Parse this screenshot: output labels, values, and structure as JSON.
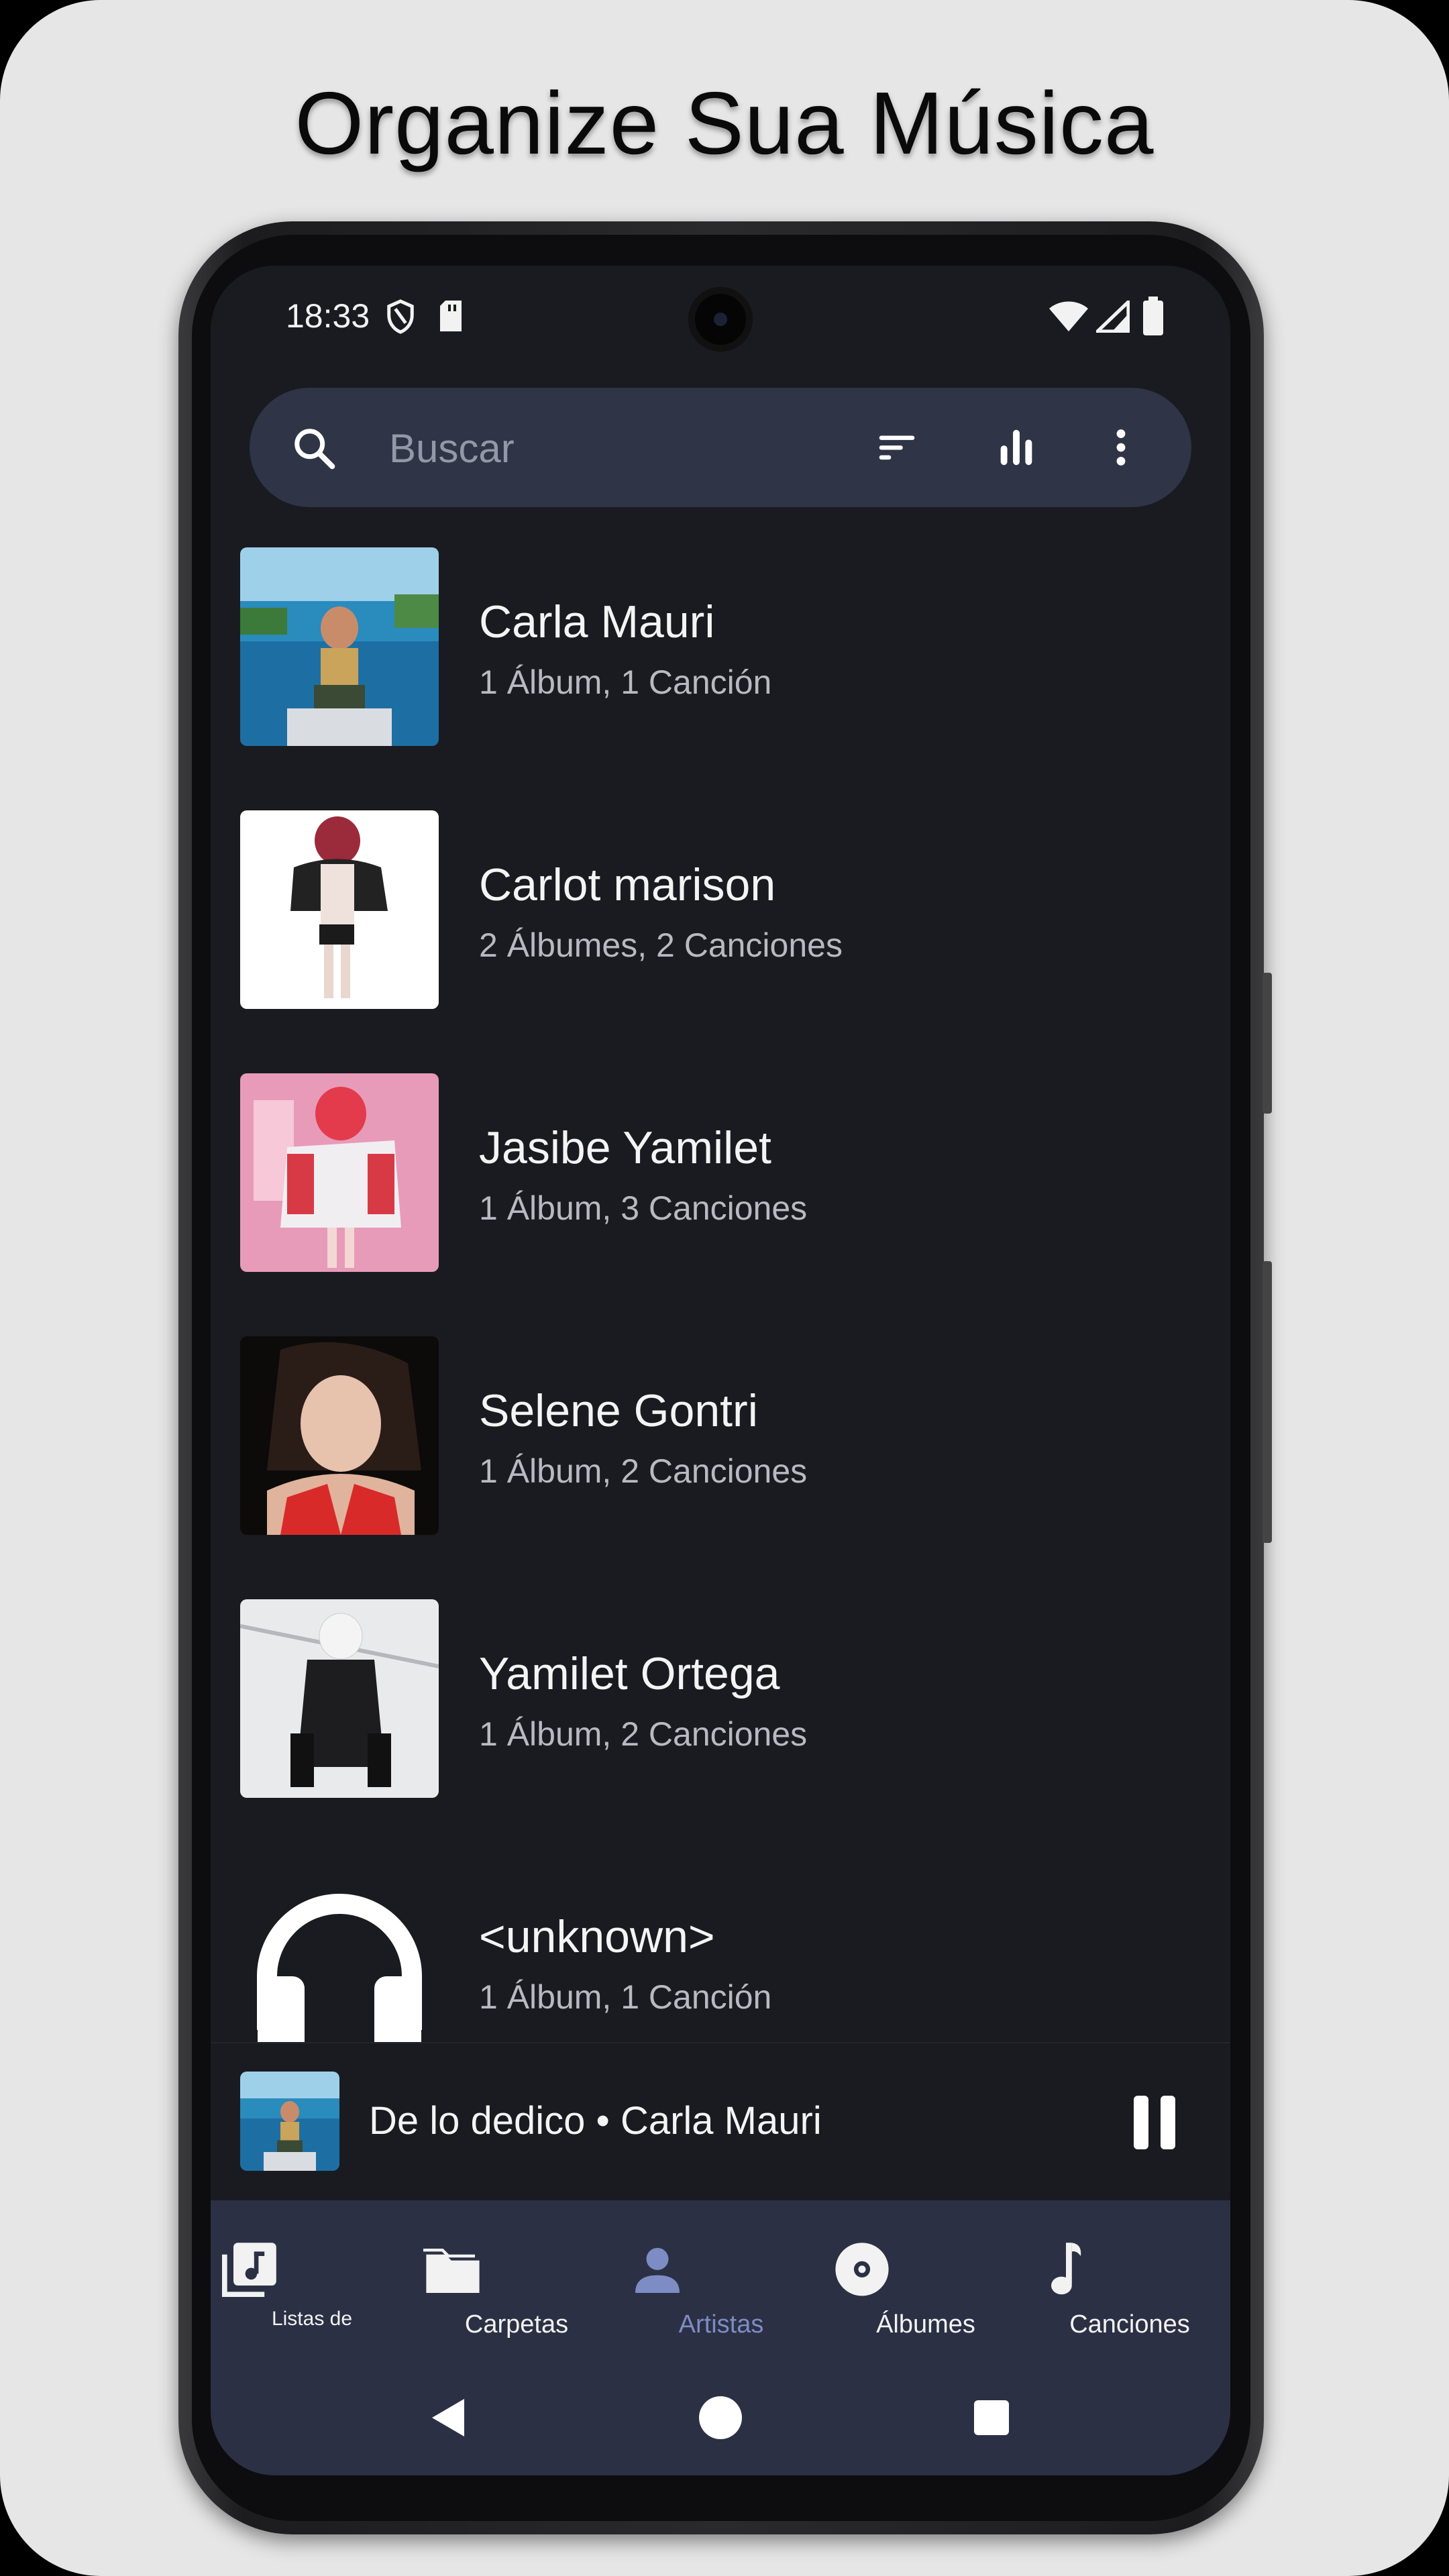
{
  "headline": "Organize Sua Música",
  "status_bar": {
    "time": "18:33",
    "icons": [
      "shield-icon",
      "sd-card-icon",
      "wifi-icon",
      "signal-icon",
      "battery-icon"
    ]
  },
  "search": {
    "placeholder": "Buscar",
    "actions": [
      "sort-icon",
      "equalizer-icon",
      "more-vert-icon"
    ]
  },
  "artists": [
    {
      "name": "Carla Mauri",
      "meta": "1 Álbum, 1 Canción"
    },
    {
      "name": "Carlot marison",
      "meta": "2 Álbumes, 2 Canciones"
    },
    {
      "name": "Jasibe Yamilet",
      "meta": "1 Álbum, 3 Canciones"
    },
    {
      "name": "Selene Gontri",
      "meta": "1 Álbum, 2 Canciones"
    },
    {
      "name": "Yamilet Ortega",
      "meta": "1 Álbum, 2 Canciones"
    },
    {
      "name": "<unknown>",
      "meta": "1 Álbum, 1 Canción"
    }
  ],
  "now_playing": {
    "title": "De lo dedico • Carla Mauri",
    "state_icon": "pause-icon"
  },
  "bottom_nav": [
    {
      "label": "Listas de",
      "icon": "playlist-icon",
      "active": false
    },
    {
      "label": "Carpetas",
      "icon": "folder-icon",
      "active": false
    },
    {
      "label": "Artistas",
      "icon": "person-icon",
      "active": true
    },
    {
      "label": "Álbumes",
      "icon": "album-disc-icon",
      "active": false
    },
    {
      "label": "Canciones",
      "icon": "music-note-icon",
      "active": false
    }
  ],
  "system_nav": [
    "back-icon",
    "home-icon",
    "recents-icon"
  ],
  "colors": {
    "screen_bg": "#1a1b20",
    "search_bg": "#2f3446",
    "nav_bg": "#2b3044",
    "accent_active": "#7d8cc4",
    "page_bg": "#e6e6e6"
  }
}
